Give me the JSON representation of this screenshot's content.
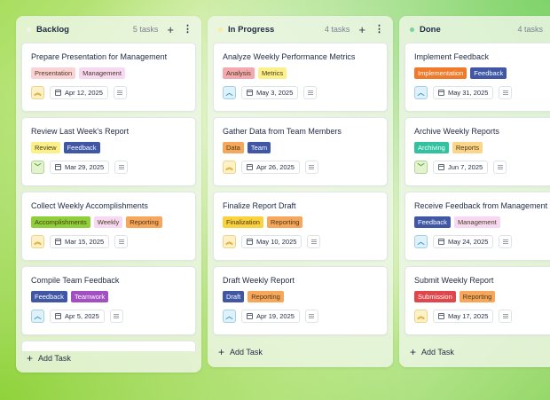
{
  "columns": [
    {
      "key": "backlog",
      "title": "Backlog",
      "count": "5 tasks",
      "dot_color": "#f1f4e8",
      "add_label": "Add Task",
      "cards": [
        {
          "title": "Prepare Presentation for Management",
          "tags": [
            [
              "Presentation",
              "#fbd3d6"
            ],
            [
              "Management",
              "#f7d9f3"
            ]
          ],
          "priority": "high",
          "date": "Apr 12, 2025"
        },
        {
          "title": "Review Last Week's Report",
          "tags": [
            [
              "Review",
              "#fbf08a"
            ],
            [
              "Feedback",
              "#3f57a5"
            ]
          ],
          "priority": "low",
          "date": "Mar 29, 2025"
        },
        {
          "title": "Collect Weekly Accomplishments",
          "tags": [
            [
              "Accomplishments",
              "#8fcf3a"
            ],
            [
              "Weekly",
              "#f7d9f3"
            ],
            [
              "Reporting",
              "#f6a75c"
            ]
          ],
          "priority": "high",
          "date": "Mar 15, 2025"
        },
        {
          "title": "Compile Team Feedback",
          "tags": [
            [
              "Feedback",
              "#3f57a5"
            ],
            [
              "Teamwork",
              "#a24fc4"
            ]
          ],
          "priority": "medium",
          "date": "Apr 5, 2025"
        }
      ]
    },
    {
      "key": "progress",
      "title": "In Progress",
      "count": "4 tasks",
      "dot_color": "#fbe9a8",
      "add_label": "Add Task",
      "cards": [
        {
          "title": "Analyze Weekly Performance Metrics",
          "tags": [
            [
              "Analysis",
              "#f4a9b0"
            ],
            [
              "Metrics",
              "#fbf08a"
            ]
          ],
          "priority": "medium",
          "date": "May 3, 2025"
        },
        {
          "title": "Gather Data from Team Members",
          "tags": [
            [
              "Data",
              "#f6a75c"
            ],
            [
              "Team",
              "#3f57a5"
            ]
          ],
          "priority": "high",
          "date": "Apr 26, 2025"
        },
        {
          "title": "Finalize Report Draft",
          "tags": [
            [
              "Finalization",
              "#f9d23e"
            ],
            [
              "Reporting",
              "#f6a75c"
            ]
          ],
          "priority": "high",
          "date": "May 10, 2025"
        },
        {
          "title": "Draft Weekly Report",
          "tags": [
            [
              "Draft",
              "#3f57a5"
            ],
            [
              "Reporting",
              "#f6a75c"
            ]
          ],
          "priority": "medium",
          "date": "Apr 19, 2025"
        }
      ]
    },
    {
      "key": "done",
      "title": "Done",
      "count": "4 tasks",
      "dot_color": "#7fcfa6",
      "add_label": "Add Task",
      "cards": [
        {
          "title": "Implement Feedback",
          "tags": [
            [
              "Implementation",
              "#f07a2a"
            ],
            [
              "Feedback",
              "#3f57a5"
            ]
          ],
          "priority": "medium",
          "date": "May 31, 2025"
        },
        {
          "title": "Archive Weekly Reports",
          "tags": [
            [
              "Archiving",
              "#33c2a0"
            ],
            [
              "Reports",
              "#fbd58a"
            ]
          ],
          "priority": "low",
          "date": "Jun 7, 2025"
        },
        {
          "title": "Receive Feedback from Management",
          "tags": [
            [
              "Feedback",
              "#3f57a5"
            ],
            [
              "Management",
              "#f7d9f3"
            ]
          ],
          "priority": "medium",
          "date": "May 24, 2025"
        },
        {
          "title": "Submit Weekly Report",
          "tags": [
            [
              "Submission",
              "#e0474c"
            ],
            [
              "Reporting",
              "#f6a75c"
            ]
          ],
          "priority": "high",
          "date": "May 17, 2025"
        }
      ]
    }
  ],
  "priority_styles": {
    "high": {
      "glyph": "︽",
      "bg": "#fdf1c6",
      "fg": "#d49a12",
      "icon": "double-chevron-up-icon"
    },
    "medium": {
      "glyph": "︿",
      "bg": "#dff1fa",
      "fg": "#2a8fc0",
      "icon": "chevron-up-icon"
    },
    "low": {
      "glyph": "﹀",
      "bg": "#e3f3cf",
      "fg": "#4f9a2a",
      "icon": "chevron-down-icon"
    }
  }
}
